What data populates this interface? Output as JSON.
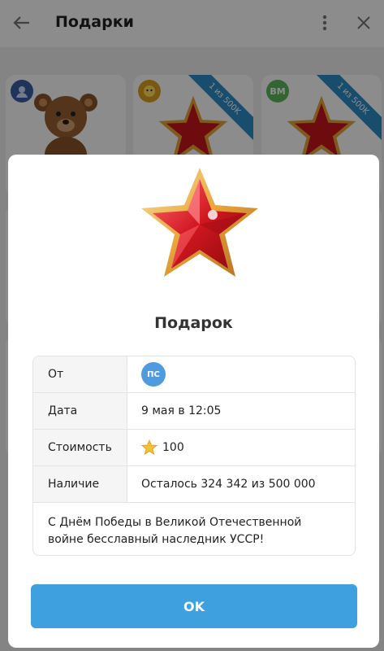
{
  "header": {
    "title": "Подарки"
  },
  "gifts": [
    {
      "avatar_text": "",
      "avatar_color": "#3a5ea8",
      "ribbon": ""
    },
    {
      "avatar_text": "",
      "avatar_color": "#e0a020",
      "ribbon": "1 из 500K"
    },
    {
      "avatar_text": "ВМ",
      "avatar_color": "#5cb85c",
      "ribbon": "1 из 500K"
    }
  ],
  "modal": {
    "title": "Подарок",
    "rows": [
      {
        "label": "От",
        "value": "",
        "avatar_text": "ПС"
      },
      {
        "label": "Дата",
        "value": "9 мая в 12:05"
      },
      {
        "label": "Стоимость",
        "value": "100"
      },
      {
        "label": "Наличие",
        "value": "Осталось 324 342 из 500 000"
      }
    ],
    "message": "С Днём Победы в Великой Отечественной войне бесславный наследник УССР!",
    "ok_label": "OK"
  },
  "colors": {
    "accent": "#3fa0e0",
    "star_red": "#d0161e",
    "star_gold": "#e8a53a"
  }
}
